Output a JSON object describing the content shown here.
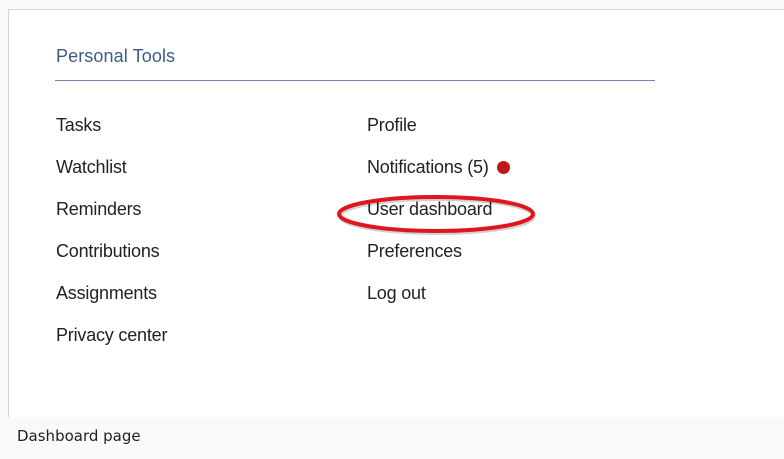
{
  "panel": {
    "title": "Personal Tools"
  },
  "left_menu": [
    {
      "label": "Tasks"
    },
    {
      "label": "Watchlist"
    },
    {
      "label": "Reminders"
    },
    {
      "label": "Contributions"
    },
    {
      "label": "Assignments"
    },
    {
      "label": "Privacy center"
    }
  ],
  "right_menu": [
    {
      "label": "Profile"
    },
    {
      "label": "Notifications (5)"
    },
    {
      "label": "User dashboard"
    },
    {
      "label": "Preferences"
    },
    {
      "label": "Log out"
    }
  ],
  "notification_badge": {
    "icon": "red-dot-icon",
    "color": "#c0171c"
  },
  "highlight": {
    "target": "User dashboard",
    "color": "#e0161e"
  },
  "caption": {
    "text": "Dashboard page"
  }
}
